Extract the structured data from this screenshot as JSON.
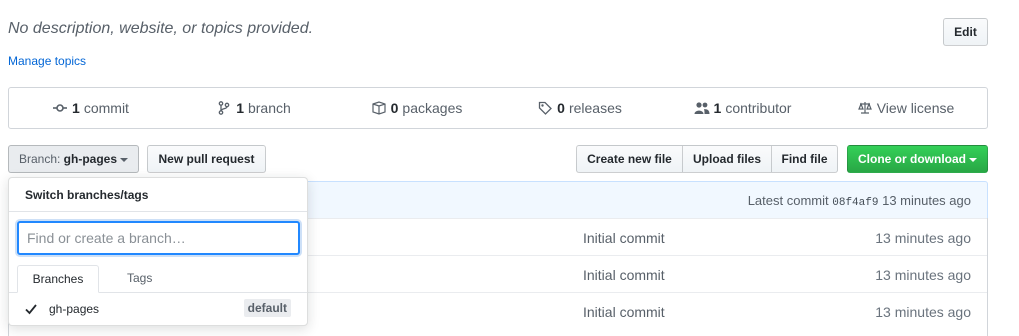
{
  "repo": {
    "description": "No description, website, or topics provided.",
    "manage_topics": "Manage topics",
    "edit_label": "Edit"
  },
  "summary": [
    {
      "icon": "commit-icon",
      "count": "1",
      "label": "commit"
    },
    {
      "icon": "branch-icon",
      "count": "1",
      "label": "branch"
    },
    {
      "icon": "package-icon",
      "count": "0",
      "label": "packages"
    },
    {
      "icon": "tag-icon",
      "count": "0",
      "label": "releases"
    },
    {
      "icon": "people-icon",
      "count": "1",
      "label": "contributor"
    },
    {
      "icon": "law-icon",
      "count": "",
      "label": "View license"
    }
  ],
  "toolbar": {
    "branch_prefix": "Branch:",
    "branch_name": "gh-pages",
    "new_pr": "New pull request",
    "create_file": "Create new file",
    "upload_files": "Upload files",
    "find_file": "Find file",
    "clone": "Clone or download"
  },
  "commit_bar": {
    "latest_label": "Latest commit",
    "sha": "08f4af9",
    "time": "13 minutes ago"
  },
  "files": [
    {
      "message": "Initial commit",
      "age": "13 minutes ago"
    },
    {
      "message": "Initial commit",
      "age": "13 minutes ago"
    },
    {
      "message": "Initial commit",
      "age": "13 minutes ago"
    }
  ],
  "branch_dropdown": {
    "title": "Switch branches/tags",
    "placeholder": "Find or create a branch…",
    "tabs": [
      "Branches",
      "Tags"
    ],
    "items": [
      {
        "name": "gh-pages",
        "badge": "default",
        "selected": true
      }
    ]
  },
  "colors": {
    "link": "#0366d6",
    "primary_green": "#28a745",
    "focus_blue": "#2188ff",
    "commit_bar_bg": "#f1f8ff"
  }
}
